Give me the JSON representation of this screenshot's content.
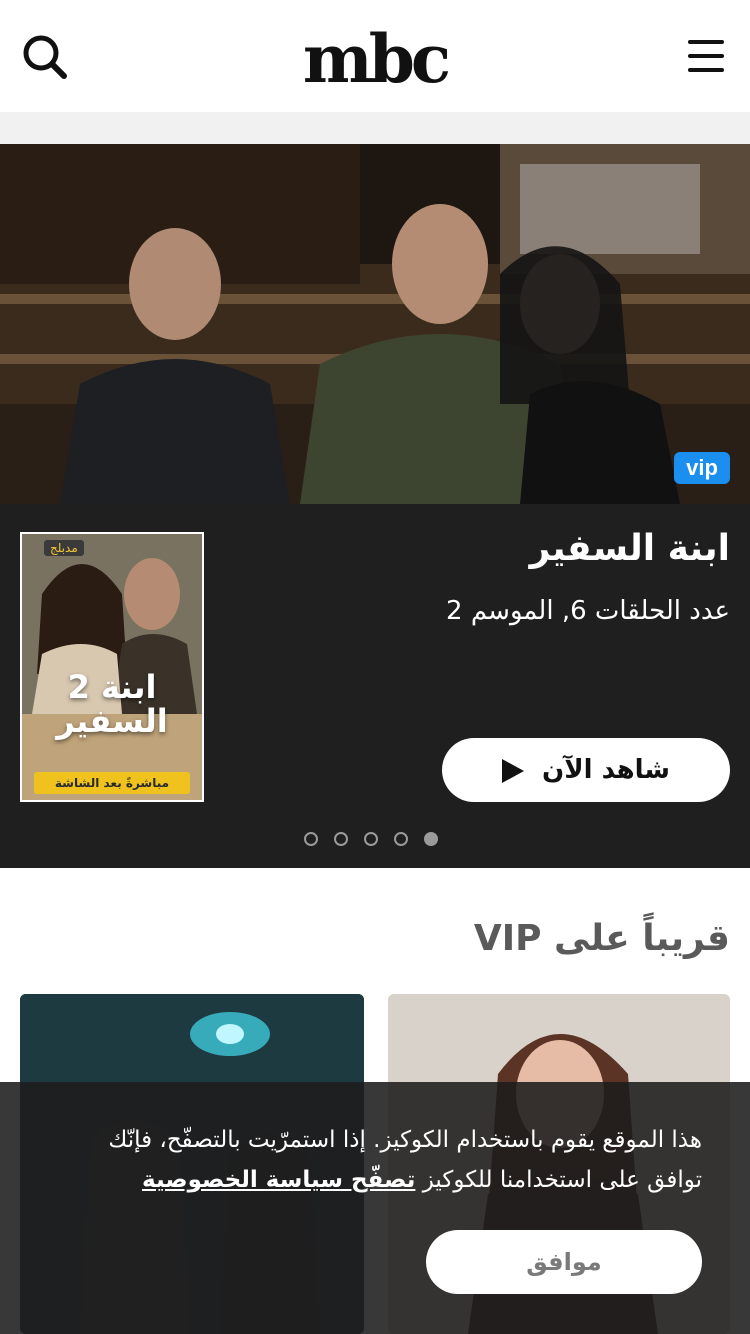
{
  "header": {
    "logo_text": "mbc"
  },
  "hero": {
    "badge": "vip",
    "title": "ابنة السفير",
    "subtitle": "عدد الحلقات 6, الموسم 2",
    "watch_label": "شاهد الآن",
    "poster": {
      "badge": "مدبلج",
      "title_line1": "ابنة 2",
      "title_line2": "السفير",
      "strip": "مباشرةً بعد الشاشة"
    },
    "dots_total": 5,
    "active_dot": 5
  },
  "section": {
    "title": "قريباً على VIP"
  },
  "cookie": {
    "text": "هذا الموقع يقوم باستخدام الكوكيز. إذا استمرّيت بالتصفّح، فإنّك توافق على استخدامنا للكوكيز",
    "link": "تصفّح سياسة الخصوصية",
    "agree_label": "موافق"
  },
  "colors": {
    "accent_vip": "#1a8ff0",
    "dark_panel": "#1f1f1f",
    "section_title": "#5a5a5a"
  },
  "icons": {
    "search": "search-icon",
    "menu": "hamburger-menu-icon",
    "play": "play-icon"
  }
}
